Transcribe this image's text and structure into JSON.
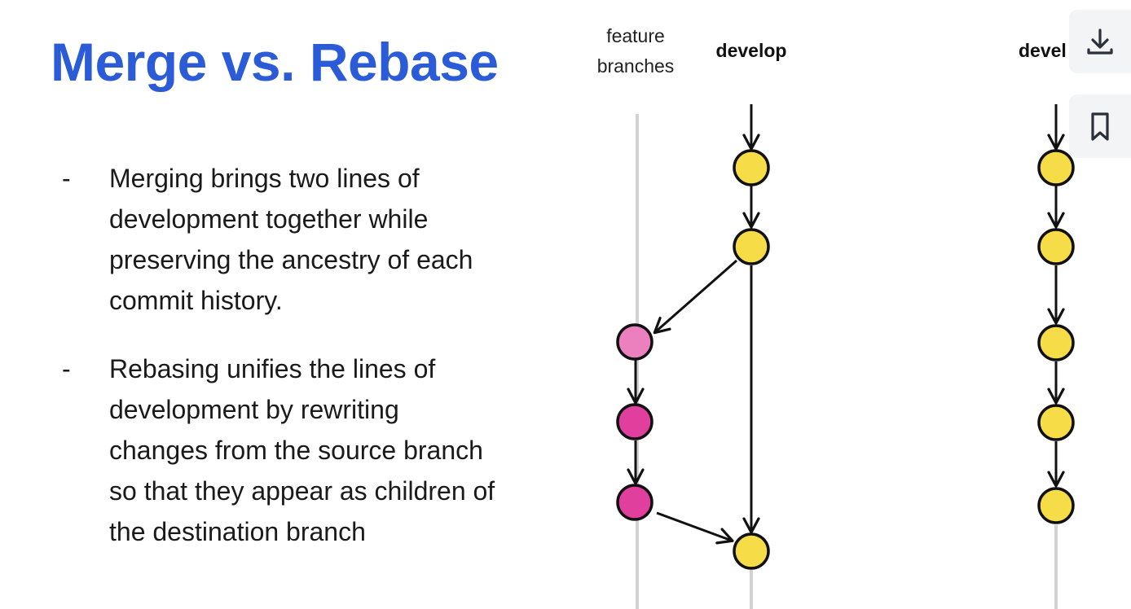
{
  "slide": {
    "title": "Merge vs. Rebase",
    "bullets": [
      {
        "marker": "-",
        "lines": [
          "Merging brings two lines of",
          "development together while",
          "preserving the ancestry of each",
          "commit history."
        ]
      },
      {
        "marker": "-",
        "lines": [
          "Rebasing unifies the lines of",
          "development by rewriting",
          "changes from the source branch",
          "so that they appear as children of",
          "the destination branch"
        ]
      }
    ]
  },
  "diagram": {
    "label_feature_line1": "feature",
    "label_feature_line2": "branches",
    "label_develop": "develop",
    "label_develop_cropped": "devel",
    "colors": {
      "develop_commit": "#f6dc46",
      "feature_commit_light": "#ec7fbe",
      "feature_commit": "#e13f9e",
      "branch_line_gray": "#cfcfcf",
      "arrow": "#111111"
    }
  },
  "toolbar": {
    "download_icon": "download-icon",
    "bookmark_icon": "bookmark-icon"
  }
}
